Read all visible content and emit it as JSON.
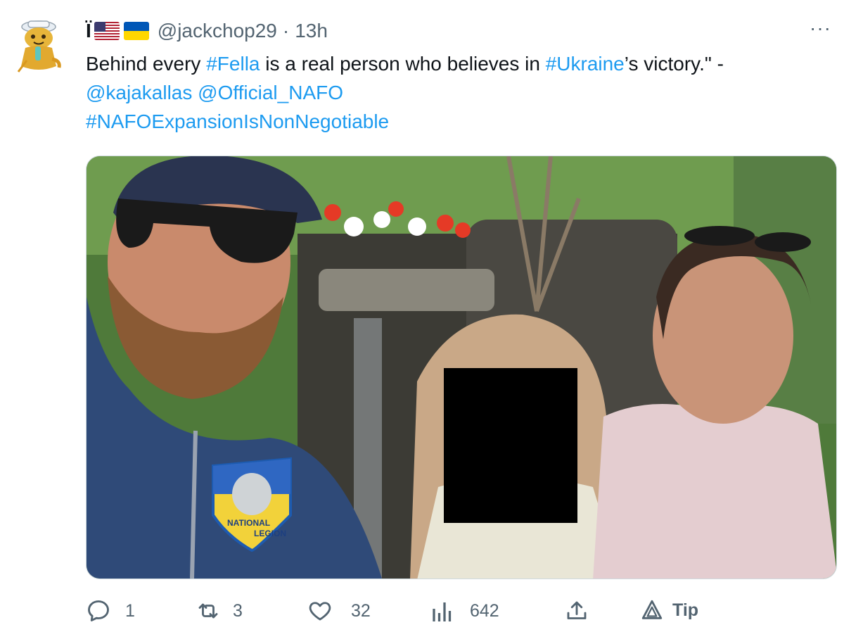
{
  "tweet": {
    "display_name": "Ï",
    "flags": [
      "us-flag-icon",
      "ukraine-flag-icon"
    ],
    "handle": "@jackchop29",
    "separator": "·",
    "time": "13h",
    "more_label": "···",
    "text": {
      "part1": "Behind every ",
      "tag_fella": "#Fella",
      "part2": " is a real person who believes in ",
      "tag_ukraine": "#Ukraine",
      "part3": "’s victory.\" -",
      "mention1": "@kajakallas",
      "mention2": "@Official_NAFO",
      "hashtag": "#NAFOExpansionIsNonNegotiable"
    },
    "media": {
      "patch_line1": "NATIONAL",
      "patch_line2": "LEGION"
    }
  },
  "actions": {
    "reply_count": "1",
    "retweet_count": "3",
    "like_count": "32",
    "views_count": "642",
    "tip_label": "Tip"
  },
  "colors": {
    "link": "#1d9bf0",
    "secondary_text": "#536471",
    "primary_text": "#0f1419"
  }
}
